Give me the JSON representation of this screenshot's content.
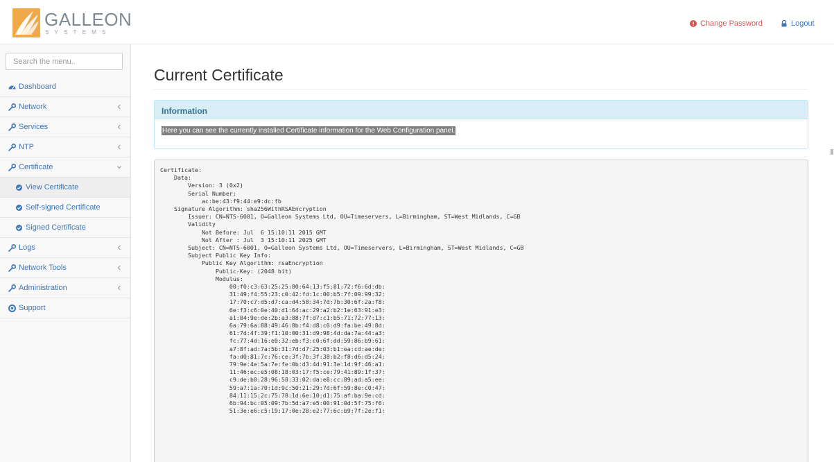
{
  "header": {
    "logo_name": "GALLEON",
    "logo_sub": "SYSTEMS",
    "change_password": "Change Password",
    "logout": "Logout"
  },
  "sidebar": {
    "search_placeholder": "Search the menu..",
    "items": [
      {
        "label": "Dashboard",
        "icon": "dashboard-icon",
        "chevron": "none"
      },
      {
        "label": "Network",
        "icon": "wrench-icon",
        "chevron": "left"
      },
      {
        "label": "Services",
        "icon": "wrench-icon",
        "chevron": "left"
      },
      {
        "label": "NTP",
        "icon": "wrench-icon",
        "chevron": "left"
      },
      {
        "label": "Certificate",
        "icon": "wrench-icon",
        "chevron": "down"
      },
      {
        "label": "View Certificate",
        "icon": "certificate-icon",
        "sub": true,
        "active": true
      },
      {
        "label": "Self-signed Certificate",
        "icon": "certificate-icon",
        "sub": true
      },
      {
        "label": "Signed Certificate",
        "icon": "certificate-icon",
        "sub": true
      },
      {
        "label": "Logs",
        "icon": "wrench-icon",
        "chevron": "left"
      },
      {
        "label": "Network Tools",
        "icon": "wrench-icon",
        "chevron": "left"
      },
      {
        "label": "Administration",
        "icon": "wrench-icon",
        "chevron": "left"
      },
      {
        "label": "Support",
        "icon": "support-icon",
        "chevron": "none"
      }
    ]
  },
  "main": {
    "title": "Current Certificate",
    "info_heading": "Information",
    "info_text": "Here you can see the currently installed Certificate information for the Web Configuration panel.",
    "certificate_text": "Certificate:\n    Data:\n        Version: 3 (0x2)\n        Serial Number:\n            ac:be:43:f9:44:e9:dc:fb\n    Signature Algorithm: sha256WithRSAEncryption\n        Issuer: CN=NTS-6001, O=Galleon Systems Ltd, OU=Timeservers, L=Birmingham, ST=West Midlands, C=GB\n        Validity\n            Not Before: Jul  6 15:10:11 2015 GMT\n            Not After : Jul  3 15:10:11 2025 GMT\n        Subject: CN=NTS-6001, O=Galleon Systems Ltd, OU=Timeservers, L=Birmingham, ST=West Midlands, C=GB\n        Subject Public Key Info:\n            Public Key Algorithm: rsaEncryption\n                Public-Key: (2048 bit)\n                Modulus:\n                    00:f0:c3:63:25:25:80:64:13:f5:81:72:f6:6d:db:\n                    31:49:f4:55:23:c0:42:fd:1c:00:b5:7f:09:99:32:\n                    17:70:c7:d5:d7:ca:d4:58:34:7d:7b:30:6f:2a:f8:\n                    6e:f3:c6:0e:40:d1:64:ac:29:a2:b2:1e:63:91:e3:\n                    a1:04:9e:de:2b:a3:88:7f:d7:c1:b5:71:72:77:13:\n                    6a:79:6a:88:49:46:8b:f4:d8:c0:d9:fa:be:49:8d:\n                    61:7d:4f:39:f1:10:00:31:d9:98:4d:da:7a:44:a3:\n                    fc:77:4d:16:e0:32:eb:f3:c0:6f:dd:59:86:b9:61:\n                    a7:8f:ad:7a:5b:31:7d:d7:25:03:b1:ea:cd:ae:de:\n                    fa:d0:81:7c:76:ce:3f:7b:3f:38:b2:f8:d6:d5:24:\n                    79:9e:4e:5a:7e:fe:0b:d3:4d:91:3e:1d:9f:46:a1:\n                    11:46:ec:e5:08:18:03:17:f5:ce:79:41:89:1f:37:\n                    c9:de:b0:28:96:58:33:02:da:e8:cc:89:ad:a5:ee:\n                    59:a7:1a:70:1d:9c:50:21:29:7d:6f:59:8e:c0:47:\n                    84:11:15:2c:75:78:1d:6e:10:d1:75:af:ba:9e:cd:\n                    6b:94:bc:05:09:7b:5d:a7:e5:00:91:0d:5f:75:f6:\n                    51:3e:e6:c5:19:17:0e:28:e2:77:6c:b9:7f:2e:f1:"
  },
  "colors": {
    "link_blue": "#3c76b8",
    "danger_red": "#d9534f",
    "info_bg": "#d9edf7",
    "info_text": "#31708f",
    "logo_orange": "#f0a94a"
  }
}
